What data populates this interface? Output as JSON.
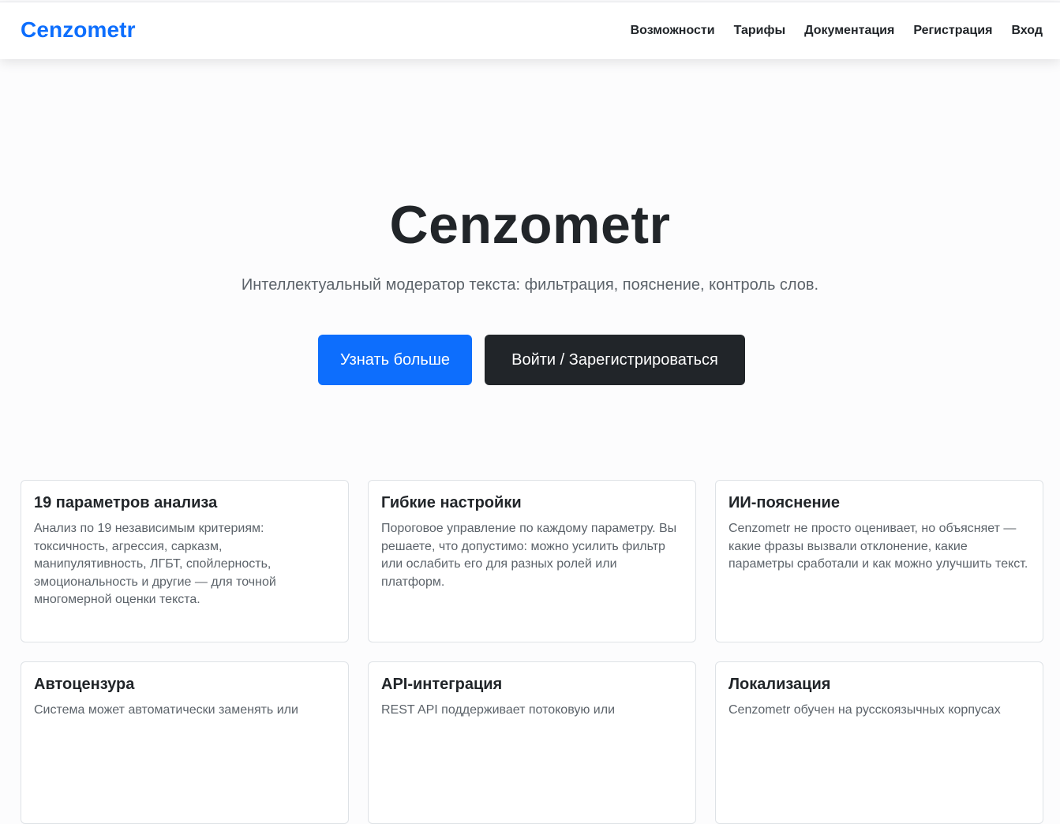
{
  "navbar": {
    "brand": "Cenzometr",
    "links": [
      "Возможности",
      "Тарифы",
      "Документация",
      "Регистрация",
      "Вход"
    ]
  },
  "hero": {
    "title": "Cenzometr",
    "subtitle": "Интеллектуальный модератор текста: фильтрация, пояснение, контроль слов.",
    "primary_button": "Узнать больше",
    "secondary_button": "Войти / Зарегистрироваться"
  },
  "features": [
    {
      "title": "19 параметров анализа",
      "text": "Анализ по 19 независимым критериям: токсичность, агрессия, сарказм, манипулятивность, ЛГБТ, спойлерность, эмоциональность и другие — для точной многомерной оценки текста."
    },
    {
      "title": "Гибкие настройки",
      "text": "Пороговое управление по каждому параметру. Вы решаете, что допустимо: можно усилить фильтр или ослабить его для разных ролей или платформ."
    },
    {
      "title": "ИИ-пояснение",
      "text": "Cenzometr не просто оценивает, но объясняет — какие фразы вызвали отклонение, какие параметры сработали и как можно улучшить текст."
    },
    {
      "title": "Автоцензура",
      "text": "Система может автоматически заменять или"
    },
    {
      "title": "API-интеграция",
      "text": "REST API поддерживает потоковую или"
    },
    {
      "title": "Локализация",
      "text": "Cenzometr обучен на русскоязычных корпусах"
    }
  ],
  "colors": {
    "brand": "#0d6efd",
    "dark_button": "#212529",
    "text_muted": "#5c636a"
  }
}
